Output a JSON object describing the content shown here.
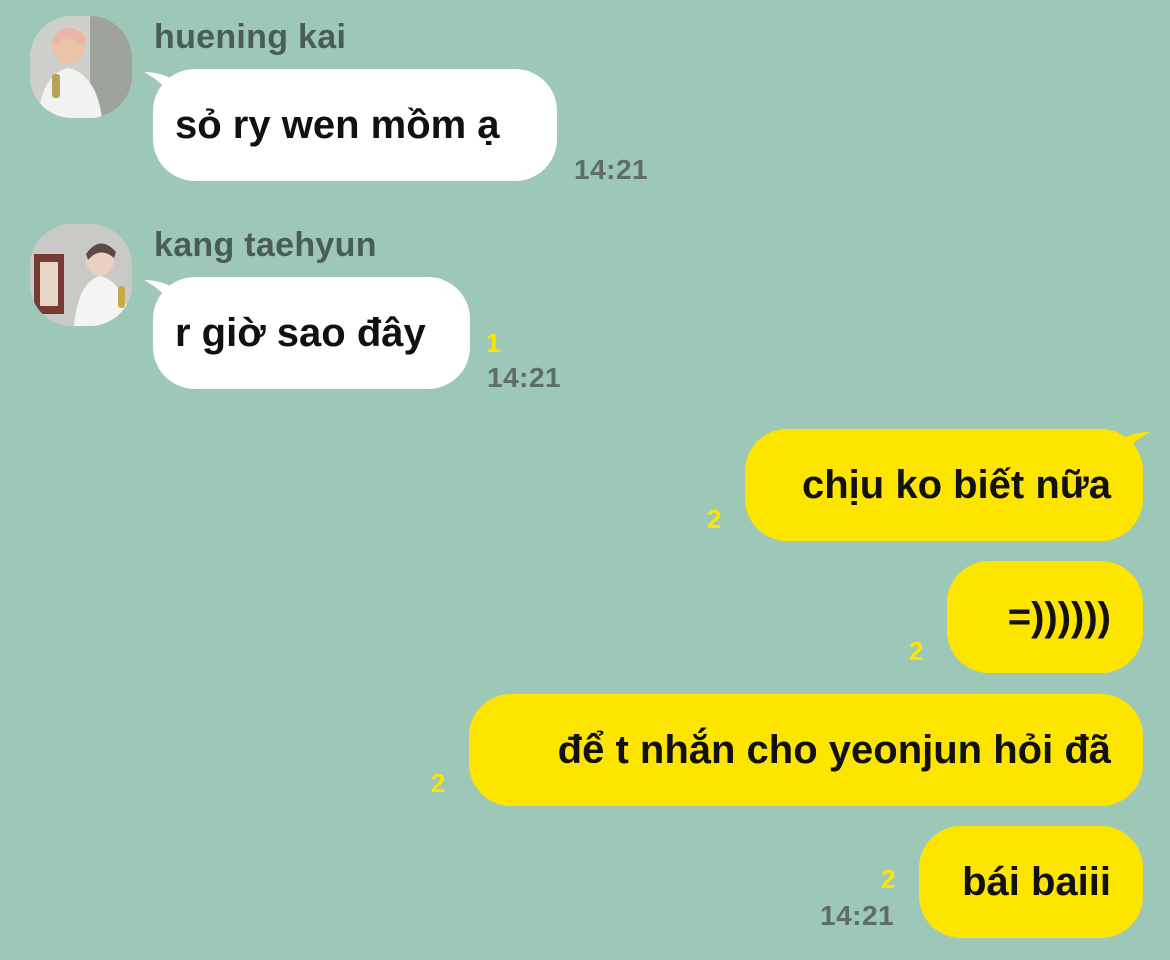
{
  "messages": [
    {
      "sender": "huening kai",
      "text": "sỏ ry wen mồm ạ",
      "time": "14:21"
    },
    {
      "sender": "kang taehyun",
      "text": "r giờ sao đây",
      "unread": "1",
      "time": "14:21"
    },
    {
      "text": "chịu ko biết nữa",
      "unread": "2"
    },
    {
      "text": "=))))))",
      "unread": "2"
    },
    {
      "text": "để t nhắn cho yeonjun hỏi đã",
      "unread": "2"
    },
    {
      "text": "bái baiii",
      "unread": "2",
      "time": "14:21"
    }
  ],
  "colors": {
    "background": "#9dc7b6",
    "incoming_bubble": "#ffffff",
    "outgoing_bubble": "#fee500",
    "unread_count": "#fee500"
  },
  "icons": {
    "avatar_1": "profile-photo",
    "avatar_2": "profile-photo"
  }
}
